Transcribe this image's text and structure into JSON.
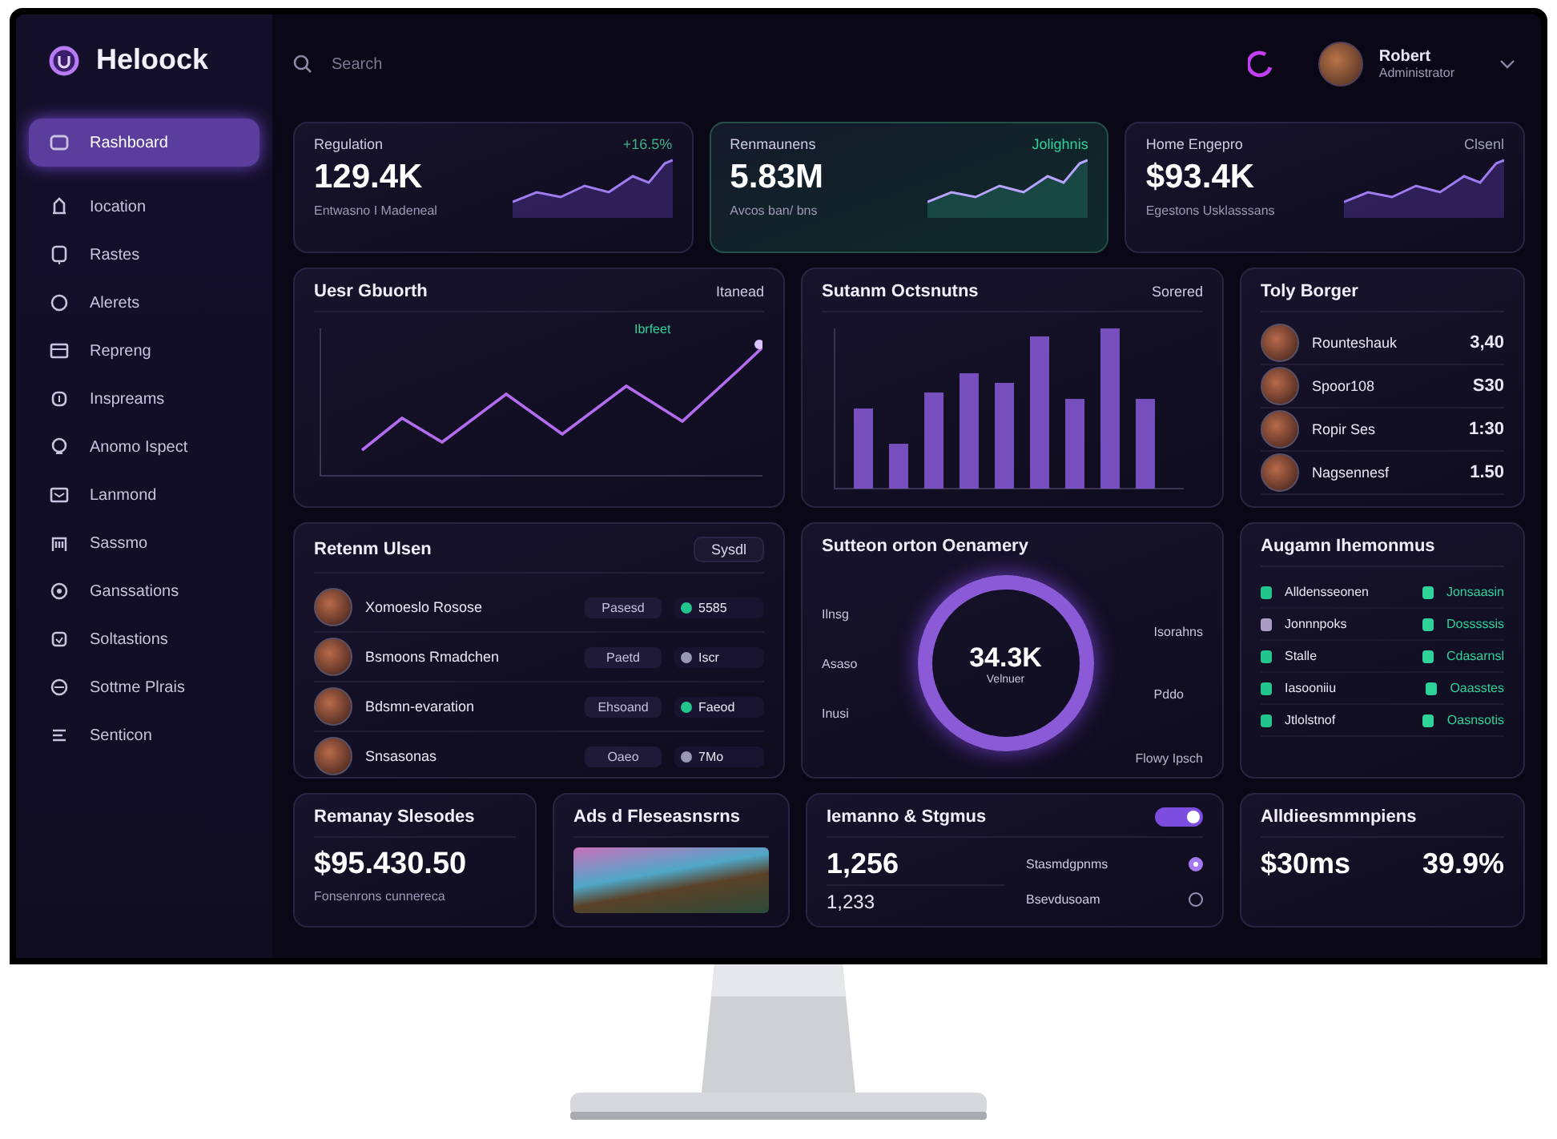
{
  "app": {
    "name": "Heloock"
  },
  "search": {
    "placeholder": "Search"
  },
  "user": {
    "name": "Robert",
    "role": "Administrator"
  },
  "sidebar": {
    "items": [
      {
        "label": "Rashboard",
        "selected": true
      },
      {
        "label": "Iocation",
        "selected": false
      },
      {
        "label": "Rastes",
        "selected": false
      },
      {
        "label": "Alerets",
        "selected": false
      },
      {
        "label": "Repreng",
        "selected": false
      },
      {
        "label": "Inspreams",
        "selected": false
      },
      {
        "label": "Anomo Ispect",
        "selected": false
      },
      {
        "label": "Lanmond",
        "selected": false
      },
      {
        "label": "Sassmo",
        "selected": false
      },
      {
        "label": "Ganssations",
        "selected": false
      },
      {
        "label": "Soltastions",
        "selected": false
      },
      {
        "label": "Sottme Plrais",
        "selected": false
      },
      {
        "label": "Senticon",
        "selected": false
      }
    ]
  },
  "kpis": [
    {
      "label": "Regulation",
      "value": "129.4K",
      "note": "Entwasno I Madeneal",
      "delta": "+16.5%",
      "color": "#3fae86",
      "highlighted": false
    },
    {
      "label": "Renmaunens",
      "value": "5.83M",
      "note": "Avcos ban/ bns",
      "delta": "Jolighnis",
      "color": "#2ed39a",
      "highlighted": true
    },
    {
      "label": "Home Engepro",
      "value": "$93.4K",
      "note": "Egestons Usklasssans",
      "delta": "Clsenl",
      "color": "#9ea3b5",
      "highlighted": false
    }
  ],
  "user_growth": {
    "title": "Uesr Gbuorth",
    "filter": "Itanead",
    "badge": "Ibrfeet"
  },
  "sessions": {
    "title": "Sutanm Octsnutns",
    "filter": "Sorered"
  },
  "top_buyers": {
    "title": "Toly Borger",
    "rows": [
      {
        "name": "Rounteshauk",
        "value": "3,40"
      },
      {
        "name": "Spoor108",
        "value": "S30"
      },
      {
        "name": "Ropir Ses",
        "value": "1:30"
      },
      {
        "name": "Nagsennesf",
        "value": "1.50"
      }
    ]
  },
  "retention": {
    "title": "Retenm Ulsen",
    "button": "Sysdl",
    "rows": [
      {
        "name": "Xomoeslo Rosose",
        "tag": "Pasesd",
        "status": "5585",
        "color": "#22c58b"
      },
      {
        "name": "Bsmoons Rmadchen",
        "tag": "Paetd",
        "status": "Iscr",
        "color": "#9a98b0"
      },
      {
        "name": "Bdsmn-evaration",
        "tag": "Ehsoand",
        "status": "Faeod",
        "color": "#22c58b"
      },
      {
        "name": "Snsasonas",
        "tag": "Oaeo",
        "status": "7Mo",
        "color": "#9a98b0"
      }
    ]
  },
  "subscriptions": {
    "title": "Sutteon orton Oenamery",
    "value": "34.3K",
    "caption": "Velnuer",
    "legend_left": [
      "Ilnsg",
      "Asaso",
      "Inusi"
    ],
    "legend_right": [
      "Isorahns",
      "Pddo"
    ],
    "footer": "Flowy Ipsch"
  },
  "applications": {
    "title": "Augamn Ihemonmus",
    "rows": [
      {
        "name": "Alldensseonen",
        "status": "Jonsaasin",
        "color": "#22c58b"
      },
      {
        "name": "Jonnnpoks",
        "status": "Dosssssis",
        "color": "#a99bc4"
      },
      {
        "name": "Stalle",
        "status": "Cdasarnsl",
        "color": "#22c58b"
      },
      {
        "name": "Iasooniiu",
        "status": "Oaasstes",
        "color": "#22c58b"
      },
      {
        "name": "Jtlolstnof",
        "status": "Oasnsotis",
        "color": "#22c58b"
      }
    ]
  },
  "remaining": {
    "title": "Remanay Slesodes",
    "value": "$95.430.50",
    "note": "Fonsenrons cunnereca"
  },
  "ads": {
    "title": "Ads d Fleseasnsrns"
  },
  "training": {
    "title": "Iemanno & Stgmus",
    "toggle": {
      "on": true
    },
    "value": "1,256",
    "value_2": "1,233",
    "options": [
      {
        "label": "Stasmdgpnms",
        "selected": true
      },
      {
        "label": "Bsevdusoam",
        "selected": false
      }
    ]
  },
  "performance": {
    "title": "Alldieesmmnpiens",
    "metrics": [
      "$30ms",
      "39.9%"
    ]
  }
}
